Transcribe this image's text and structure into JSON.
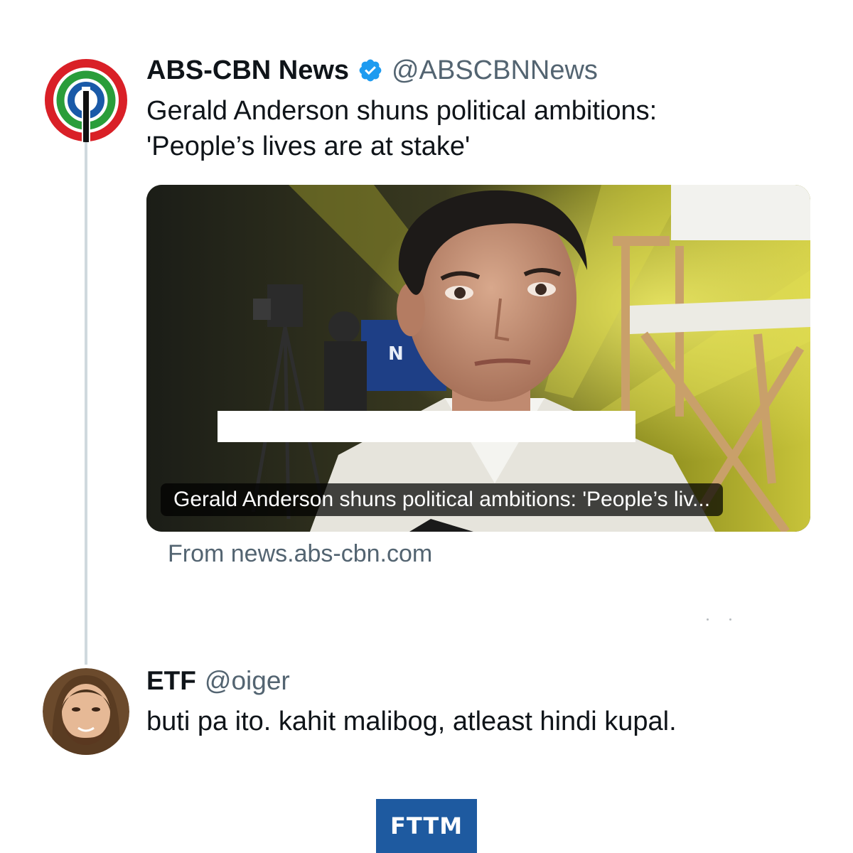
{
  "tweet": {
    "display_name": "ABS-CBN News",
    "verified_icon": "verified-badge-icon",
    "handle": "@ABSCBNNews",
    "text_line1": "Gerald Anderson shuns political ambitions:",
    "text_line2": "'People’s lives are at stake'",
    "card": {
      "title": "Gerald Anderson shuns political ambitions: 'People’s liv...",
      "source": "From news.abs-cbn.com",
      "sign_text": "N"
    }
  },
  "reply": {
    "display_name": "ETF",
    "handle": "@oiger",
    "text": "buti pa ito. kahit malibog, atleast hindi kupal."
  },
  "footer": {
    "logo_text": "FTTM"
  },
  "colors": {
    "verified_blue": "#1d9bf0",
    "handle_gray": "#536471",
    "thread_line": "#cfd9de",
    "logo_blue": "#1e5aa0",
    "abs_red": "#d92027",
    "abs_green": "#2a9d3a",
    "abs_blue": "#1a5aa8"
  }
}
